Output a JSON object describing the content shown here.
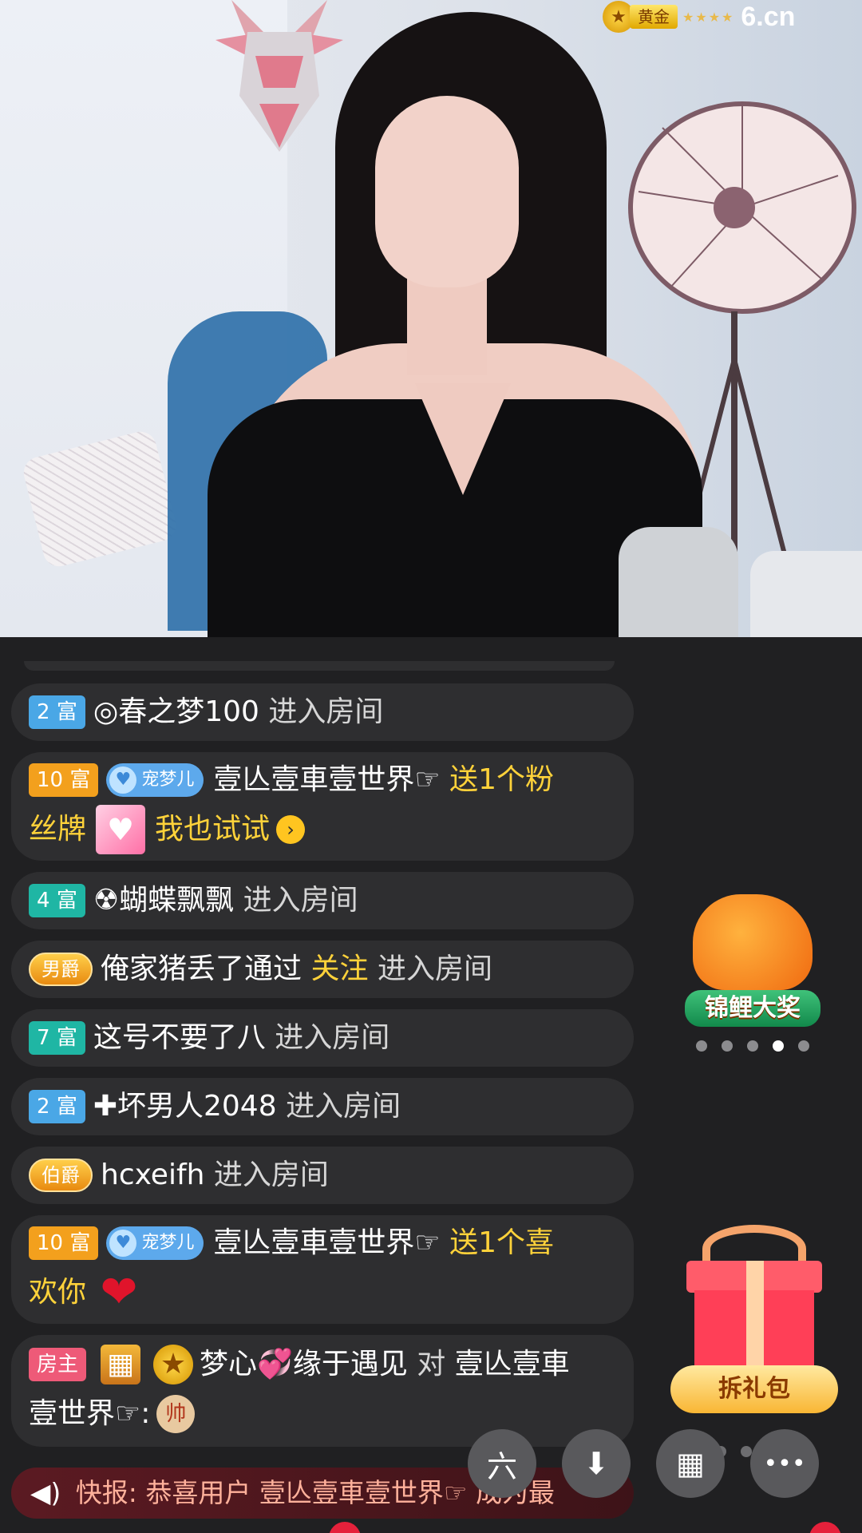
{
  "top_badge": {
    "medal_icon": "star-medal-icon",
    "level": "黄金",
    "logo": "6.cn"
  },
  "chat": [
    {
      "level": "2",
      "rich": "富",
      "name": "◎春之梦100",
      "action": "进入房间"
    },
    {
      "level": "10",
      "rich": "富",
      "fan": "宠梦儿",
      "fan_num": "1",
      "name": "壹亾壹車壹世界☞",
      "gift_text1": "送1个粉",
      "gift_text2": "丝牌",
      "cta": "我也试试"
    },
    {
      "level": "4",
      "rich": "富",
      "name": "☢蝴蝶飘飘",
      "action": "进入房间"
    },
    {
      "noble": "男爵",
      "name": "俺家猪丢了通过",
      "via": "关注",
      "action": "进入房间"
    },
    {
      "level": "7",
      "rich": "富",
      "name": "这号不要了八",
      "action": "进入房间"
    },
    {
      "level": "2",
      "rich": "富",
      "name": "✚坏男人2048",
      "action": "进入房间"
    },
    {
      "noble": "伯爵",
      "name": "hcxeifh",
      "action": "进入房间"
    },
    {
      "level": "10",
      "rich": "富",
      "fan": "宠梦儿",
      "fan_num": "2",
      "name": "壹亾壹車壹世界☞",
      "gift_text1": "送1个喜",
      "gift_text2": "欢你",
      "love": "Love"
    },
    {
      "host": "房主",
      "name": "梦心💞缘于遇见",
      "to": "对",
      "target1": "壹亾壹車",
      "target2": "壹世界☞:",
      "emoji": "帅"
    }
  ],
  "koi": {
    "label": "锦鲤大奖"
  },
  "giftbox": {
    "button": "拆礼包"
  },
  "bottom_buttons": [
    {
      "name": "six-logo-button",
      "glyph": "六"
    },
    {
      "name": "download-button",
      "glyph": "⬇"
    },
    {
      "name": "grid-menu-button",
      "glyph": "▦"
    },
    {
      "name": "more-button",
      "glyph": "•••"
    }
  ],
  "news": {
    "label": "快报:",
    "text": "恭喜用户 壹亾壹車壹世界☞ 成为最"
  }
}
